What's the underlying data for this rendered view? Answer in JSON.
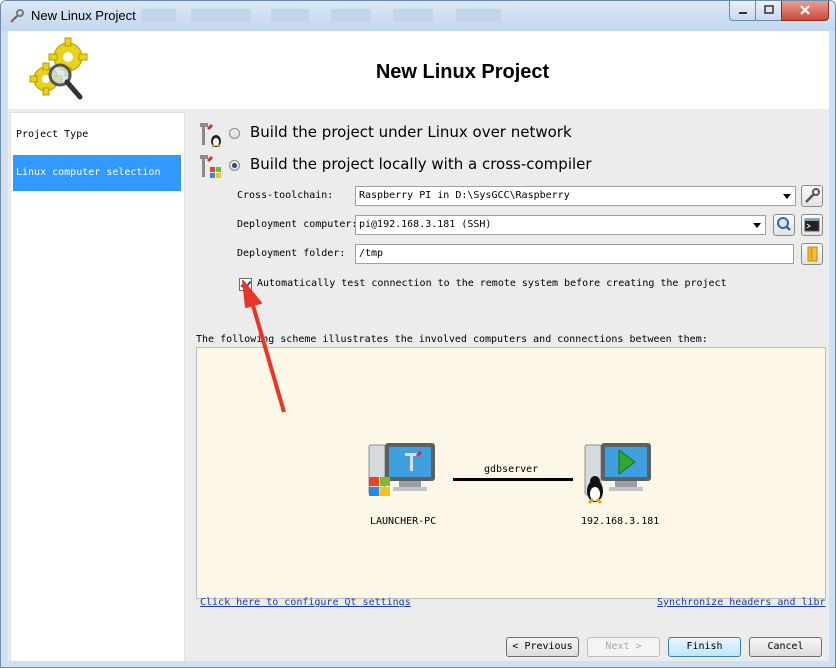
{
  "window": {
    "title": "New Linux Project",
    "icon": "gear-tool-icon"
  },
  "header": {
    "title": "New Linux Project",
    "logo": "gears-magnifier-icon"
  },
  "sidebar": {
    "items": [
      {
        "label": "Project Type",
        "selected": false
      },
      {
        "label": "Linux computer selection",
        "selected": true
      }
    ]
  },
  "build_options": [
    {
      "label": "Build the project under Linux over network",
      "selected": false,
      "icon": "tools-linux-icon"
    },
    {
      "label": "Build the project locally with a cross-compiler",
      "selected": true,
      "icon": "tools-windows-icon"
    }
  ],
  "fields": {
    "toolchain_label": "Cross-toolchain:",
    "toolchain_value": "Raspberry PI in D:\\SysGCC\\Raspberry",
    "computer_label": "Deployment computer:",
    "computer_value": "pi@192.168.3.181 (SSH)",
    "folder_label": "Deployment folder:",
    "folder_value": "/tmp"
  },
  "auto_test": {
    "checked": true,
    "label": "Automatically test connection to the remote system before creating the project"
  },
  "scheme": {
    "caption": "The following scheme illustrates the involved computers and connections between them:",
    "local_name": "LAUNCHER-PC",
    "connection": "gdbserver",
    "remote_name": "192.168.3.181",
    "link_qt": "Click here to configure Qt settings",
    "link_sync": "Synchronize headers and libr"
  },
  "buttons": {
    "previous": "Previous",
    "next": "Next",
    "finish": "Finish",
    "cancel": "Cancel"
  },
  "colors": {
    "selection": "#3399ff",
    "annotation_arrow": "#e8352a",
    "scheme_background": "#fdf7e7"
  }
}
